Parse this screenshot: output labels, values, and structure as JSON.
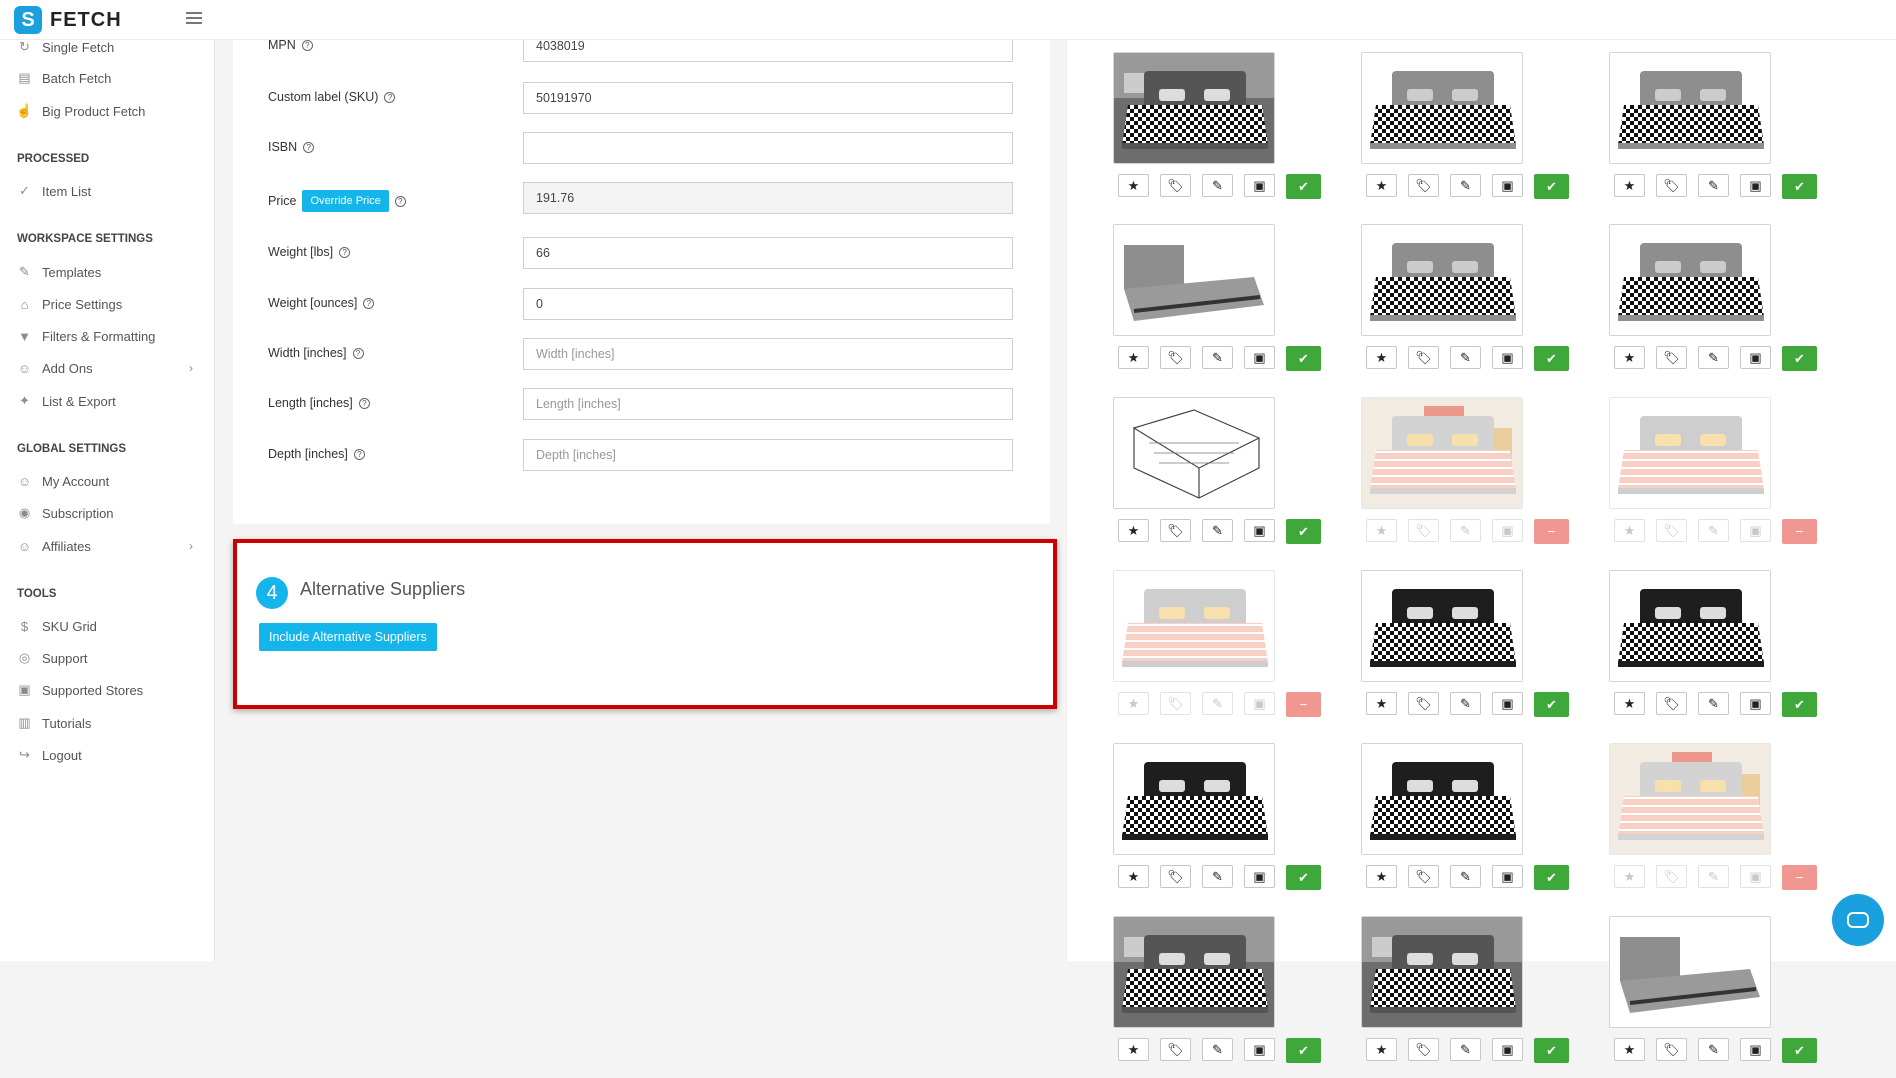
{
  "app": {
    "name": "FETCH",
    "logo_letter": "S"
  },
  "sidebar": {
    "top_items": [
      {
        "label": "Single Fetch",
        "icon": "fetch-icon"
      },
      {
        "label": "Batch Fetch",
        "icon": "batch-icon"
      },
      {
        "label": "Big Product Fetch",
        "icon": "hand-icon"
      }
    ],
    "processed_title": "PROCESSED",
    "processed_items": [
      {
        "label": "Item List",
        "icon": "check-icon"
      }
    ],
    "workspace_title": "WORKSPACE SETTINGS",
    "workspace_items": [
      {
        "label": "Templates",
        "icon": "brush-icon"
      },
      {
        "label": "Price Settings",
        "icon": "tag-icon"
      },
      {
        "label": "Filters & Formatting",
        "icon": "filter-icon"
      },
      {
        "label": "Add Ons",
        "icon": "user-plus-icon"
      },
      {
        "label": "List & Export",
        "icon": "wand-icon"
      }
    ],
    "global_title": "GLOBAL SETTINGS",
    "global_items": [
      {
        "label": "My Account",
        "icon": "user-icon"
      },
      {
        "label": "Subscription",
        "icon": "subscription-icon"
      },
      {
        "label": "Affiliates",
        "icon": "affiliates-icon"
      }
    ],
    "tools_title": "TOOLS",
    "tools_items": [
      {
        "label": "SKU Grid",
        "icon": "sku-icon"
      },
      {
        "label": "Support",
        "icon": "lifebuoy-icon"
      },
      {
        "label": "Supported Stores",
        "icon": "store-icon"
      },
      {
        "label": "Tutorials",
        "icon": "books-icon"
      },
      {
        "label": "Logout",
        "icon": "logout-icon"
      }
    ]
  },
  "form": {
    "mpn": {
      "label": "MPN",
      "value": "4038019"
    },
    "sku": {
      "label": "Custom label (SKU)",
      "value": "50191970"
    },
    "isbn": {
      "label": "ISBN",
      "value": ""
    },
    "price": {
      "label": "Price",
      "override_label": "Override Price",
      "value": "191.76"
    },
    "weight_lbs": {
      "label": "Weight [lbs]",
      "value": "66"
    },
    "weight_oz": {
      "label": "Weight [ounces]",
      "value": "0"
    },
    "width": {
      "label": "Width [inches]",
      "placeholder": "Width [inches]"
    },
    "length": {
      "label": "Length [inches]",
      "placeholder": "Length [inches]"
    },
    "depth": {
      "label": "Depth [inches]",
      "placeholder": "Depth [inches]"
    }
  },
  "alt_suppliers": {
    "step": "4",
    "title": "Alternative Suppliers",
    "button": "Include Alternative Suppliers"
  },
  "images": [
    {
      "scene": "room",
      "enabled": true
    },
    {
      "scene": "houndstooth-gray",
      "enabled": true
    },
    {
      "scene": "houndstooth-gray",
      "enabled": true
    },
    {
      "scene": "frame-only",
      "enabled": true
    },
    {
      "scene": "houndstooth-gray",
      "enabled": true
    },
    {
      "scene": "houndstooth-gray",
      "enabled": true
    },
    {
      "scene": "diagram",
      "enabled": true
    },
    {
      "scene": "room-coral",
      "enabled": false
    },
    {
      "scene": "coral",
      "enabled": false
    },
    {
      "scene": "coral",
      "enabled": false
    },
    {
      "scene": "houndstooth-black",
      "enabled": true
    },
    {
      "scene": "houndstooth-black",
      "enabled": true
    },
    {
      "scene": "houndstooth-black",
      "enabled": true
    },
    {
      "scene": "houndstooth-black",
      "enabled": true
    },
    {
      "scene": "room-coral",
      "enabled": false
    },
    {
      "scene": "room",
      "enabled": true
    },
    {
      "scene": "room",
      "enabled": true
    },
    {
      "scene": "frame-only",
      "enabled": true
    }
  ],
  "image_buttons": {
    "star": "★",
    "tag": "🏷",
    "pencil": "✎",
    "image": "▣",
    "check": "✔",
    "minus": "−"
  },
  "colors": {
    "accent": "#13b5ea",
    "enabled": "#3ea83b",
    "disabled": "#f19792",
    "highlight": "#cc0000"
  }
}
